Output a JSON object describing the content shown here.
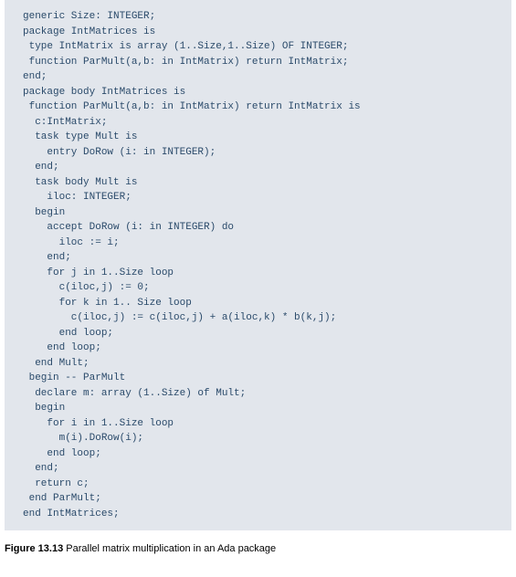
{
  "code": {
    "lines": [
      "generic Size: INTEGER;",
      "package IntMatrices is",
      " type IntMatrix is array (1..Size,1..Size) OF INTEGER;",
      " function ParMult(a,b: in IntMatrix) return IntMatrix;",
      "end;",
      "",
      "package body IntMatrices is",
      " function ParMult(a,b: in IntMatrix) return IntMatrix is",
      "  c:IntMatrix;",
      "",
      "  task type Mult is",
      "    entry DoRow (i: in INTEGER);",
      "  end;",
      "  task body Mult is",
      "    iloc: INTEGER;",
      "  begin",
      "",
      "    accept DoRow (i: in INTEGER) do",
      "      iloc := i;",
      "    end;",
      "    for j in 1..Size loop",
      "      c(iloc,j) := 0;",
      "      for k in 1.. Size loop",
      "        c(iloc,j) := c(iloc,j) + a(iloc,k) * b(k,j);",
      "      end loop;",
      "    end loop;",
      "  end Mult;",
      "",
      " begin -- ParMult",
      "  declare m: array (1..Size) of Mult;",
      "  begin",
      "    for i in 1..Size loop",
      "      m(i).DoRow(i);",
      "    end loop;",
      "  end;",
      "  return c;",
      " end ParMult;",
      "end IntMatrices;"
    ]
  },
  "caption": {
    "label": "Figure 13.13",
    "text": " Parallel matrix multiplication in an Ada package"
  }
}
